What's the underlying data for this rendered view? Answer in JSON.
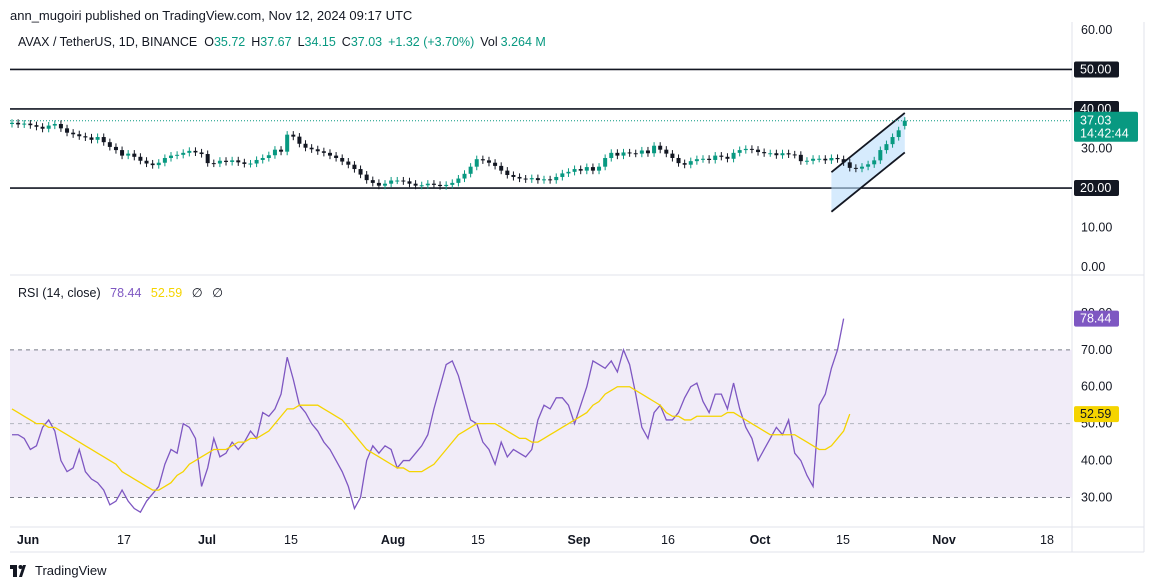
{
  "header": {
    "published": "ann_mugoiri published on TradingView.com, Nov 12, 2024 09:17 UTC"
  },
  "legend": {
    "symbol": "AVAX / TetherUS, 1D, BINANCE",
    "o_label": "O",
    "o_value": "35.72",
    "h_label": "H",
    "h_value": "37.67",
    "l_label": "L",
    "l_value": "34.15",
    "c_label": "C",
    "c_value": "37.03",
    "change": "+1.32 (+3.70%)",
    "vol_label": "Vol",
    "vol_value": "3.264 M"
  },
  "rsi_legend": {
    "label": "RSI (14, close)",
    "rsi_value": "78.44",
    "ma_value": "52.59",
    "icon1": "∅",
    "icon2": "∅"
  },
  "footer": {
    "brand": "TradingView"
  },
  "colors": {
    "up": "#089981",
    "down": "#131722",
    "rsi": "#7e57c2",
    "rsi_ma": "#f5d400",
    "band": "#ede7f6",
    "channel_fill": "#bbdefb",
    "price_tag": "#089981"
  },
  "chart_data": [
    {
      "type": "candlestick",
      "title": "AVAX / TetherUS, 1D, BINANCE",
      "ylim": [
        -2,
        62
      ],
      "y_ticks": [
        "60.00",
        "50.00",
        "40.00",
        "30.00",
        "20.00",
        "10.00",
        "0.00"
      ],
      "x_ticks": [
        "Jun",
        "17",
        "Jul",
        "15",
        "Aug",
        "15",
        "Sep",
        "16",
        "Oct",
        "15",
        "Nov",
        "18"
      ],
      "horizontal_levels": [
        {
          "value": 50,
          "label": "50.00"
        },
        {
          "value": 40,
          "label": "40.00"
        },
        {
          "value": 20,
          "label": "20.00"
        }
      ],
      "last_price": {
        "value": 37.03,
        "label": "37.03",
        "countdown": "14:42:44"
      },
      "channel": {
        "upper": [
          [
            40,
            24
          ],
          [
            52,
            39
          ]
        ],
        "lower": [
          [
            40,
            14
          ],
          [
            52,
            29
          ]
        ]
      },
      "close": [
        36.5,
        36.1,
        36.3,
        35.9,
        35.5,
        35.0,
        35.8,
        36.2,
        35.1,
        34.0,
        33.6,
        33.1,
        32.8,
        32.2,
        32.9,
        31.6,
        30.4,
        29.6,
        28.2,
        28.7,
        27.9,
        26.9,
        26.2,
        25.8,
        26.4,
        27.6,
        28.2,
        28.4,
        28.9,
        29.4,
        29.0,
        28.6,
        26.3,
        26.2,
        26.9,
        26.6,
        27.0,
        26.5,
        26.1,
        26.2,
        27.1,
        27.6,
        28.3,
        29.7,
        29.2,
        33.5,
        33.0,
        31.2,
        30.2,
        29.8,
        29.3,
        28.9,
        28.2,
        27.6,
        26.7,
        25.9,
        24.8,
        23.4,
        22.0,
        21.3,
        20.6,
        21.1,
        21.9,
        21.9,
        21.7,
        21.1,
        20.6,
        20.7,
        21.1,
        20.8,
        20.5,
        20.8,
        21.3,
        22.4,
        23.6,
        25.4,
        27.3,
        27.0,
        26.4,
        25.6,
        24.4,
        23.3,
        22.8,
        22.4,
        22.2,
        22.5,
        22.0,
        22.2,
        22.0,
        22.8,
        23.7,
        24.1,
        24.8,
        24.4,
        25.3,
        24.4,
        25.4,
        27.6,
        28.9,
        28.2,
        29.0,
        28.8,
        28.7,
        29.5,
        28.8,
        30.7,
        29.7,
        28.7,
        27.6,
        26.3,
        25.9,
        26.8,
        27.3,
        27.4,
        27.1,
        28.2,
        27.9,
        27.4,
        28.9,
        29.6,
        29.9,
        29.7,
        29.1,
        28.8,
        28.8,
        28.3,
        28.8,
        28.5,
        28.4,
        26.8,
        26.9,
        27.4,
        27.4,
        27.0,
        27.6,
        27.3,
        26.5,
        25.1,
        24.9,
        25.4,
        26.0,
        27.0,
        29.6,
        31.1,
        32.9,
        34.6,
        37.03
      ],
      "open": [
        36.2,
        36.5,
        36.1,
        36.3,
        35.9,
        35.5,
        35.0,
        35.8,
        36.2,
        35.1,
        34.0,
        33.6,
        33.1,
        32.8,
        32.2,
        32.9,
        31.6,
        30.4,
        29.6,
        28.2,
        28.7,
        27.9,
        26.9,
        26.2,
        25.8,
        26.4,
        27.6,
        28.2,
        28.4,
        28.9,
        29.4,
        29.0,
        28.6,
        26.3,
        26.2,
        26.9,
        26.6,
        27.0,
        26.5,
        26.1,
        26.2,
        27.1,
        27.6,
        28.3,
        29.7,
        29.2,
        33.5,
        33.0,
        31.2,
        30.2,
        29.8,
        29.3,
        28.9,
        28.2,
        27.6,
        26.7,
        25.9,
        24.8,
        23.4,
        22.0,
        21.3,
        20.6,
        21.1,
        21.9,
        21.9,
        21.7,
        21.1,
        20.6,
        20.7,
        21.1,
        20.8,
        20.5,
        20.8,
        21.3,
        22.4,
        23.6,
        25.4,
        27.3,
        27.0,
        26.4,
        25.6,
        24.4,
        23.3,
        22.8,
        22.4,
        22.2,
        22.5,
        22.0,
        22.2,
        22.0,
        22.8,
        23.7,
        24.1,
        24.8,
        24.4,
        25.3,
        24.4,
        25.4,
        27.6,
        28.9,
        28.2,
        29.0,
        28.8,
        28.7,
        29.5,
        28.8,
        30.7,
        29.7,
        28.7,
        27.6,
        26.3,
        25.9,
        26.8,
        27.3,
        27.4,
        27.1,
        28.2,
        27.9,
        27.4,
        28.9,
        29.6,
        29.9,
        29.7,
        29.1,
        28.8,
        28.8,
        28.3,
        28.8,
        28.5,
        28.4,
        26.8,
        26.9,
        27.4,
        27.4,
        27.0,
        27.6,
        27.3,
        26.5,
        25.1,
        24.9,
        25.4,
        26.0,
        27.0,
        29.6,
        31.1,
        32.9,
        35.72
      ]
    },
    {
      "type": "line",
      "title": "RSI (14, close)",
      "ylim": [
        22,
        90
      ],
      "y_ticks": [
        "80.00",
        "70.00",
        "60.00",
        "50.00",
        "40.00",
        "30.00"
      ],
      "band": [
        30,
        70
      ],
      "midline": 50,
      "series": [
        {
          "name": "RSI",
          "values": [
            47,
            47,
            46,
            43,
            44,
            49,
            51,
            48,
            40,
            37,
            38,
            43,
            37,
            35,
            34,
            32,
            28,
            29,
            32,
            29,
            27,
            26,
            29,
            31,
            33,
            39,
            43,
            42,
            50,
            49,
            46,
            33,
            38,
            46,
            41,
            42,
            45,
            43,
            45,
            48,
            46,
            53,
            52,
            54,
            58,
            68,
            62,
            55,
            53,
            50,
            48,
            45,
            43,
            40,
            37,
            33,
            27,
            30,
            40,
            44,
            42,
            44,
            43,
            38,
            40,
            40,
            42,
            44,
            47,
            54,
            60,
            66,
            67,
            63,
            57,
            51,
            50,
            45,
            43,
            39,
            45,
            41,
            43,
            42,
            41,
            43,
            51,
            55,
            54,
            57,
            57,
            55,
            50,
            55,
            60,
            67,
            66,
            65,
            67,
            64,
            70,
            66,
            58,
            49,
            46,
            53,
            55,
            51,
            51,
            53,
            57,
            60,
            61,
            56,
            53,
            58,
            58,
            54,
            61,
            54,
            49,
            46,
            40,
            43,
            46,
            49,
            47,
            51,
            42,
            40,
            36,
            33,
            55,
            58,
            65,
            70,
            78.44
          ]
        },
        {
          "name": "MA",
          "values": [
            54,
            53,
            52,
            51,
            50,
            50,
            49,
            49,
            48,
            47,
            46,
            45,
            44,
            43,
            42,
            41,
            40,
            39,
            37,
            36,
            35,
            34,
            33,
            32,
            32,
            33,
            34,
            36,
            37,
            39,
            40,
            41,
            42,
            43,
            43,
            43,
            44,
            45,
            45,
            46,
            46,
            47,
            48,
            50,
            52,
            54,
            54,
            55,
            55,
            55,
            55,
            54,
            53,
            52,
            51,
            49,
            47,
            45,
            43,
            42,
            41,
            40,
            39,
            38,
            38,
            37,
            37,
            37,
            38,
            39,
            41,
            43,
            45,
            47,
            48,
            49,
            50,
            50,
            50,
            50,
            49,
            48,
            47,
            46,
            46,
            45,
            45,
            46,
            47,
            48,
            49,
            50,
            51,
            52,
            53,
            55,
            56,
            58,
            59,
            60,
            60,
            60,
            59,
            58,
            57,
            56,
            55,
            53,
            52,
            52,
            51,
            51,
            52,
            52,
            52,
            52,
            52,
            53,
            53,
            52,
            51,
            50,
            49,
            48,
            47,
            47,
            47,
            47,
            47,
            46,
            45,
            44,
            43,
            43,
            44,
            46,
            48,
            52.59
          ]
        }
      ]
    }
  ]
}
